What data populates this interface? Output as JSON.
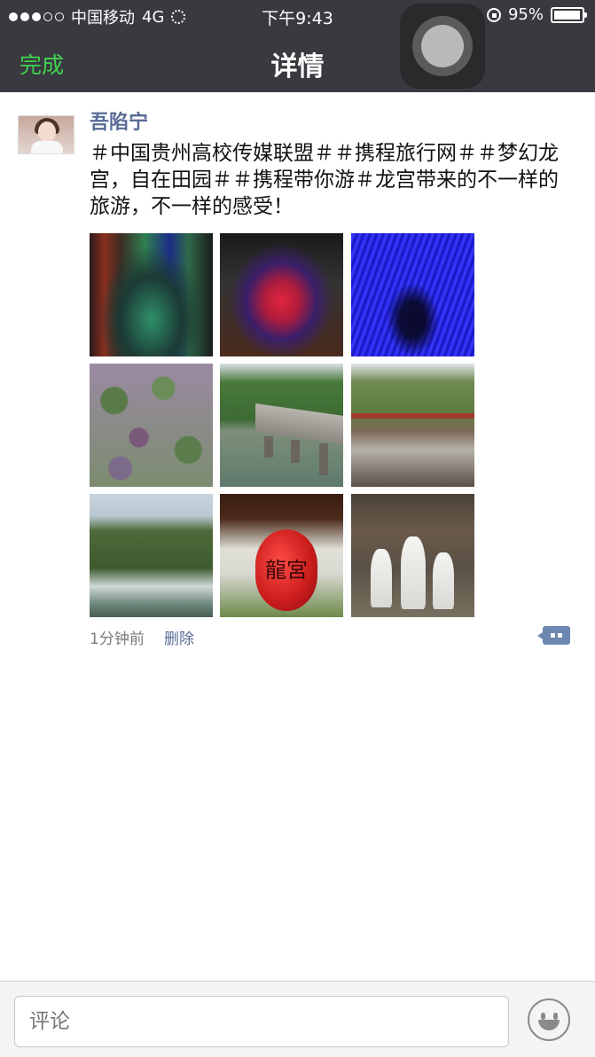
{
  "status_bar": {
    "carrier": "中国移动",
    "network": "4G",
    "time": "下午9:43",
    "battery": "95%",
    "battery_level": 0.95,
    "signal_bars": 3
  },
  "nav": {
    "done_label": "完成",
    "title": "详情"
  },
  "post": {
    "username": "吾陷宁",
    "content": "＃中国贵州高校传媒联盟＃＃携程旅行网＃＃梦幻龙宫，自在田园＃＃携程带你游＃龙宫带来的不一样的旅游，不一样的感受！",
    "photo_text": "龍宮",
    "photos": [
      {
        "subject": "colorful-cave"
      },
      {
        "subject": "cave-red-light"
      },
      {
        "subject": "blue-light-tunnel"
      },
      {
        "subject": "lily-pads"
      },
      {
        "subject": "stone-bridge-river"
      },
      {
        "subject": "riverside-rocks"
      },
      {
        "subject": "waterfall"
      },
      {
        "subject": "red-lantern"
      },
      {
        "subject": "white-statues"
      }
    ],
    "time_ago": "1分钟前",
    "delete_label": "删除"
  },
  "comment_bar": {
    "placeholder": "评论"
  },
  "colors": {
    "nav_bg": "#393a3f",
    "done_green": "#3fd34f",
    "link_blue": "#576b95"
  }
}
